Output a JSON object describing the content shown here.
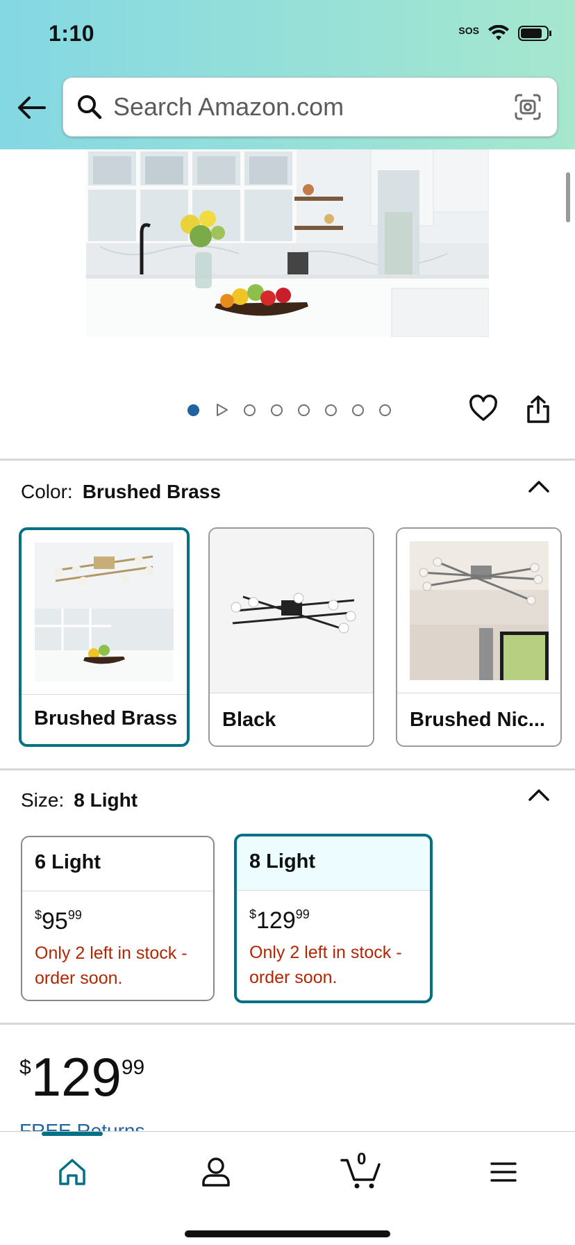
{
  "status_bar": {
    "time": "1:10",
    "sos": "SOS"
  },
  "search": {
    "placeholder": "Search Amazon.com"
  },
  "gallery": {
    "dot_count": 8,
    "active_index": 0
  },
  "color_section": {
    "label": "Color:",
    "selected": "Brushed Brass",
    "options": [
      {
        "label": "Brushed Brass",
        "selected": true
      },
      {
        "label": "Black",
        "selected": false
      },
      {
        "label": "Brushed Nic...",
        "selected": false
      }
    ]
  },
  "size_section": {
    "label": "Size:",
    "selected": "8 Light",
    "options": [
      {
        "label": "6 Light",
        "price_whole": "95",
        "price_frac": "99",
        "currency": "$",
        "stock": "Only 2 left in stock - order soon.",
        "selected": false
      },
      {
        "label": "8 Light",
        "price_whole": "129",
        "price_frac": "99",
        "currency": "$",
        "stock": "Only 2 left in stock - order soon.",
        "selected": true
      }
    ]
  },
  "price": {
    "currency": "$",
    "whole": "129",
    "fraction": "99"
  },
  "returns_link": "FREE Returns",
  "bottom_nav": {
    "cart_count": "0"
  },
  "colors": {
    "accent": "#007185",
    "link": "#2162a1",
    "stock_warning": "#b12704"
  }
}
